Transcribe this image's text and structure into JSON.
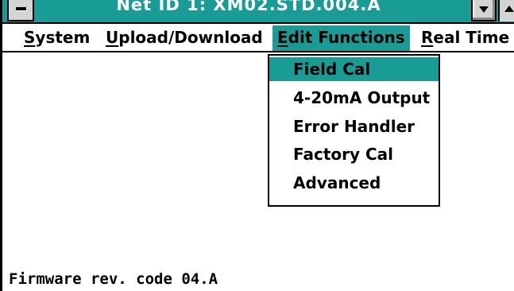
{
  "window": {
    "title": "Net ID 1: XM02.STD.004.A"
  },
  "menubar": {
    "items": [
      {
        "label": "System",
        "mnemonic": "S"
      },
      {
        "label": "Upload/Download",
        "mnemonic": "U"
      },
      {
        "label": "Edit Functions",
        "mnemonic": "E",
        "active": true
      },
      {
        "label": "Real Time",
        "mnemonic": "R"
      }
    ]
  },
  "dropdown": {
    "items": [
      {
        "label": "Field Cal",
        "selected": true
      },
      {
        "label": "4-20mA Output"
      },
      {
        "label": "Error Handler"
      },
      {
        "label": "Factory Cal"
      },
      {
        "label": "Advanced"
      }
    ]
  },
  "status": {
    "text": "Firmware rev. code 04.A"
  },
  "colors": {
    "accent": "#1a9c96",
    "background": "#ffffff",
    "text": "#000000",
    "button_face": "#d4d4d4"
  },
  "icons": {
    "system_menu": "system-menu-icon",
    "minimize": "minimize-arrow-icon",
    "maximize": "maximize-arrow-icon"
  }
}
